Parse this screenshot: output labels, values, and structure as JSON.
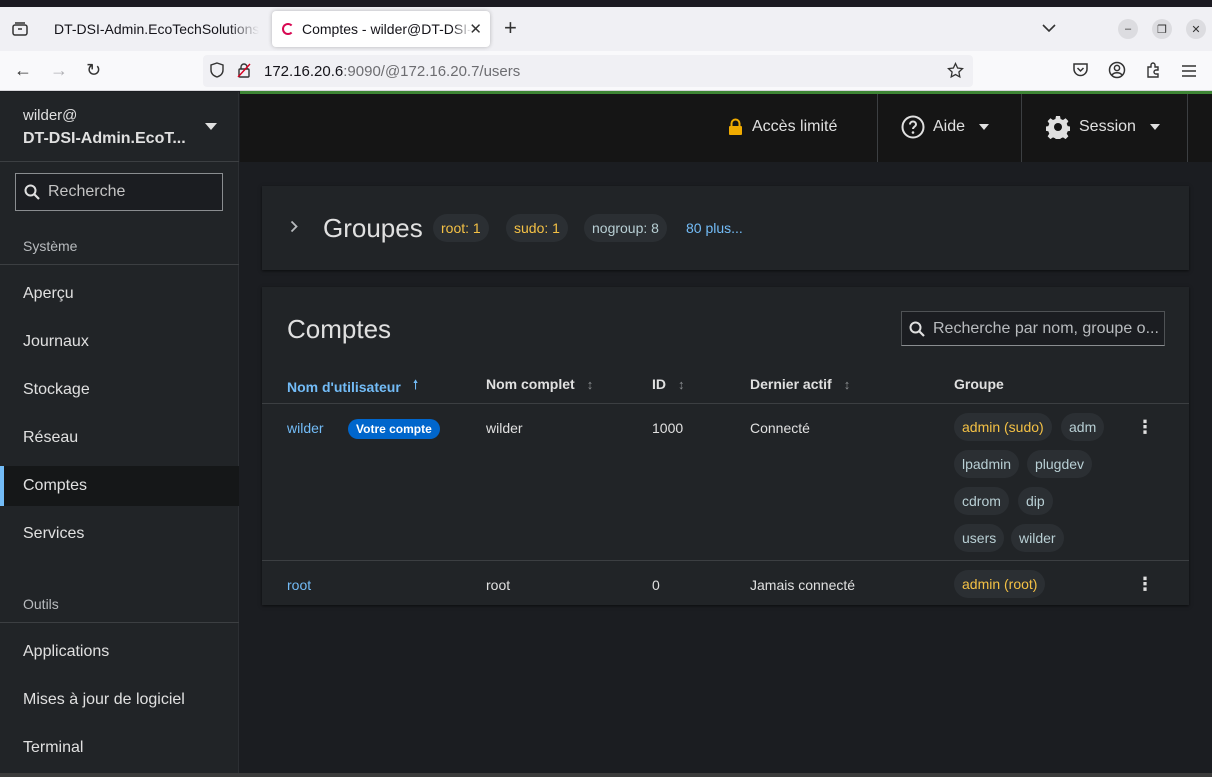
{
  "browser": {
    "tabs": [
      {
        "title": "DT-DSI-Admin.EcoTechSolutions"
      },
      {
        "title": "Comptes - wilder@DT-DSI-Admin"
      }
    ],
    "url": {
      "host": "172.16.20.6",
      "rest": ":9090/@172.16.20.7/users"
    }
  },
  "sidebar": {
    "host_user": "wilder@",
    "host_name": "DT-DSI-Admin.EcoT...",
    "search_placeholder": "Recherche",
    "section_system": "Système",
    "items_system": [
      "Aperçu",
      "Journaux",
      "Stockage",
      "Réseau",
      "Comptes",
      "Services"
    ],
    "active_item": "Comptes",
    "section_tools": "Outils",
    "items_tools": [
      "Applications",
      "Mises à jour de logiciel",
      "Terminal"
    ]
  },
  "topbar": {
    "limited_access": "Accès limité",
    "help": "Aide",
    "session": "Session"
  },
  "groups": {
    "title": "Groupes",
    "chips": [
      {
        "label": "root: 1",
        "color": "gold"
      },
      {
        "label": "sudo: 1",
        "color": "gold"
      },
      {
        "label": "nogroup: 8",
        "color": "teal"
      }
    ],
    "more": "80 plus..."
  },
  "accounts": {
    "title": "Comptes",
    "search_placeholder": "Recherche par nom, groupe o...",
    "columns": {
      "username": "Nom d'utilisateur",
      "fullname": "Nom complet",
      "id": "ID",
      "last_active": "Dernier actif",
      "group": "Groupe"
    },
    "your_account_badge": "Votre compte",
    "rows": [
      {
        "username": "wilder",
        "fullname": "wilder",
        "id": "1000",
        "last_active": "Connecté",
        "groups": [
          "admin (sudo)",
          "adm",
          "lpadmin",
          "plugdev",
          "cdrom",
          "dip",
          "users",
          "wilder"
        ]
      },
      {
        "username": "root",
        "fullname": "root",
        "id": "0",
        "last_active": "Jamais connecté",
        "groups": [
          "admin (root)"
        ]
      }
    ]
  },
  "colors": {
    "accent_link": "#73bcf7",
    "admin_group": "#f4c145",
    "badge_blue": "#0066cc",
    "header_green": "#3e8635"
  }
}
